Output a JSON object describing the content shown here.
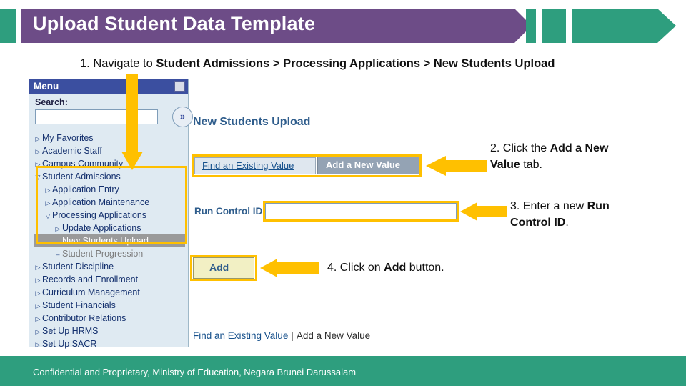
{
  "header": {
    "title": "Upload Student Data Template"
  },
  "steps": {
    "step1_prefix": "1. Navigate to ",
    "step1_path": "Student Admissions > Processing Applications > New Students Upload",
    "step2_a": "2. Click the ",
    "step2_b": "Add a New Value",
    "step2_c": " tab.",
    "step3_a": "3. Enter a new ",
    "step3_b": "Run Control ID",
    "step3_c": ".",
    "step4_a": "4. Click on ",
    "step4_b": "Add",
    "step4_c": " button."
  },
  "menu": {
    "title": "Menu",
    "collapse_icon": "minus-icon",
    "search_label": "Search:",
    "search_value": "",
    "search_placeholder": "",
    "go_icon": "double-chevron-right-icon",
    "items": [
      {
        "label": "My Favorites",
        "indent": 1,
        "marker": "collapsed",
        "state": "normal"
      },
      {
        "label": "Academic Staff",
        "indent": 1,
        "marker": "collapsed",
        "state": "normal"
      },
      {
        "label": "Campus Community",
        "indent": 1,
        "marker": "collapsed",
        "state": "normal"
      },
      {
        "label": "Student Admissions",
        "indent": 1,
        "marker": "expanded",
        "state": "normal"
      },
      {
        "label": "Application Entry",
        "indent": 2,
        "marker": "collapsed",
        "state": "normal"
      },
      {
        "label": "Application Maintenance",
        "indent": 2,
        "marker": "collapsed",
        "state": "normal"
      },
      {
        "label": "Processing Applications",
        "indent": 2,
        "marker": "expanded",
        "state": "normal"
      },
      {
        "label": "Update Applications",
        "indent": 3,
        "marker": "collapsed",
        "state": "normal"
      },
      {
        "label": "New Students Upload",
        "indent": 3,
        "marker": "leaf",
        "state": "selected"
      },
      {
        "label": "Student Progression",
        "indent": 3,
        "marker": "leaf",
        "state": "dim"
      },
      {
        "label": "Student Discipline",
        "indent": 1,
        "marker": "collapsed",
        "state": "normal"
      },
      {
        "label": "Records and Enrollment",
        "indent": 1,
        "marker": "collapsed",
        "state": "normal"
      },
      {
        "label": "Curriculum Management",
        "indent": 1,
        "marker": "collapsed",
        "state": "normal"
      },
      {
        "label": "Student Financials",
        "indent": 1,
        "marker": "collapsed",
        "state": "normal"
      },
      {
        "label": "Contributor Relations",
        "indent": 1,
        "marker": "collapsed",
        "state": "normal"
      },
      {
        "label": "Set Up HRMS",
        "indent": 1,
        "marker": "collapsed",
        "state": "normal"
      },
      {
        "label": "Set Up SACR",
        "indent": 1,
        "marker": "collapsed",
        "state": "normal"
      }
    ]
  },
  "panel": {
    "title": "New Students Upload",
    "tab_find": "Find an Existing Value",
    "tab_add": "Add a New Value",
    "run_control_label": "Run Control ID",
    "run_control_value": "",
    "add_button": "Add",
    "footer_link_find": "Find an Existing Value",
    "footer_separator": "|",
    "footer_link_add": "Add a New Value"
  },
  "footer": {
    "text": "Confidential and Proprietary, Ministry of Education, Negara Brunei Darussalam"
  },
  "colors": {
    "purple": "#6d4c87",
    "teal": "#2e9e7e",
    "highlight": "#ffc000",
    "menu_titlebar": "#3b4fa0"
  }
}
